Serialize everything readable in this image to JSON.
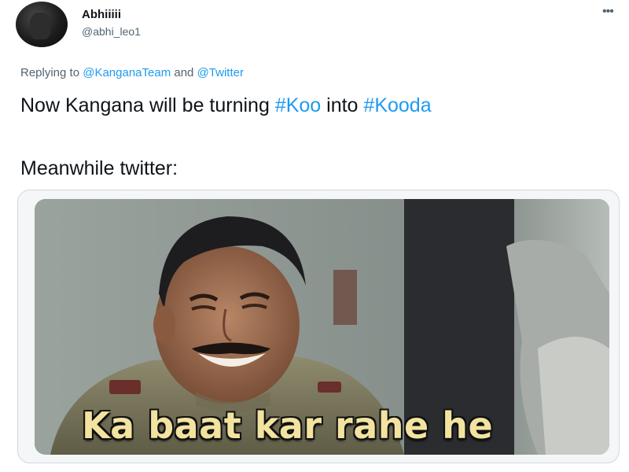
{
  "tweet": {
    "display_name": "Abhiiiii",
    "handle": "@abhi_leo1",
    "more_icon": "more-options-icon",
    "reply": {
      "prefix": "Replying to",
      "mention1": "@KanganaTeam",
      "joiner": "and",
      "mention2": "@Twitter"
    },
    "line1": {
      "text_a": "Now Kangana will be turning",
      "hashtag1": "#Koo",
      "text_b": "into",
      "hashtag2": "#Kooda"
    },
    "line2": "Meanwhile twitter:",
    "media": {
      "caption": "Ka baat kar rahe he"
    }
  },
  "colors": {
    "link": "#1d9bf0",
    "text": "#0f1419",
    "secondary": "#536471",
    "caption": "#f2e3a0"
  }
}
